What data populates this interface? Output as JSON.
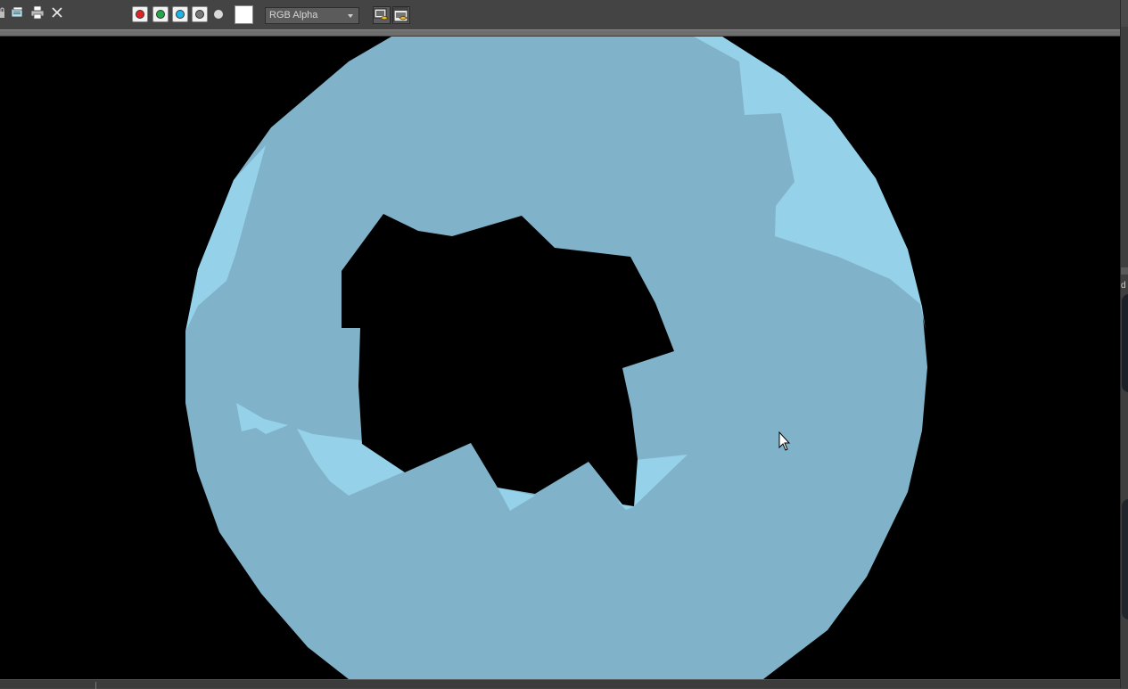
{
  "toolbar": {
    "icons": [
      "lock-icon",
      "clone-frame-icon",
      "print-icon",
      "close-icon"
    ],
    "channels": [
      {
        "name": "red-channel-toggle",
        "color": "#e02424"
      },
      {
        "name": "green-channel-toggle",
        "color": "#22a84a"
      },
      {
        "name": "blue-channel-toggle",
        "color": "#1fb4e6"
      },
      {
        "name": "alpha-channel-toggle",
        "color": "#777777"
      }
    ],
    "mono_icon": "monochrome-icon",
    "swatch_color": "#ffffff",
    "channel_select": {
      "value": "RGB Alpha"
    },
    "render_buttons": [
      "render-setup-icon",
      "environment-effects-icon"
    ]
  },
  "viewport": {
    "background": "#000000",
    "sphere_color": "#80b3c9",
    "highlight_color": "#95d1e9",
    "hole_color": "#000000"
  },
  "right_strip": {
    "partial_text": "d"
  }
}
